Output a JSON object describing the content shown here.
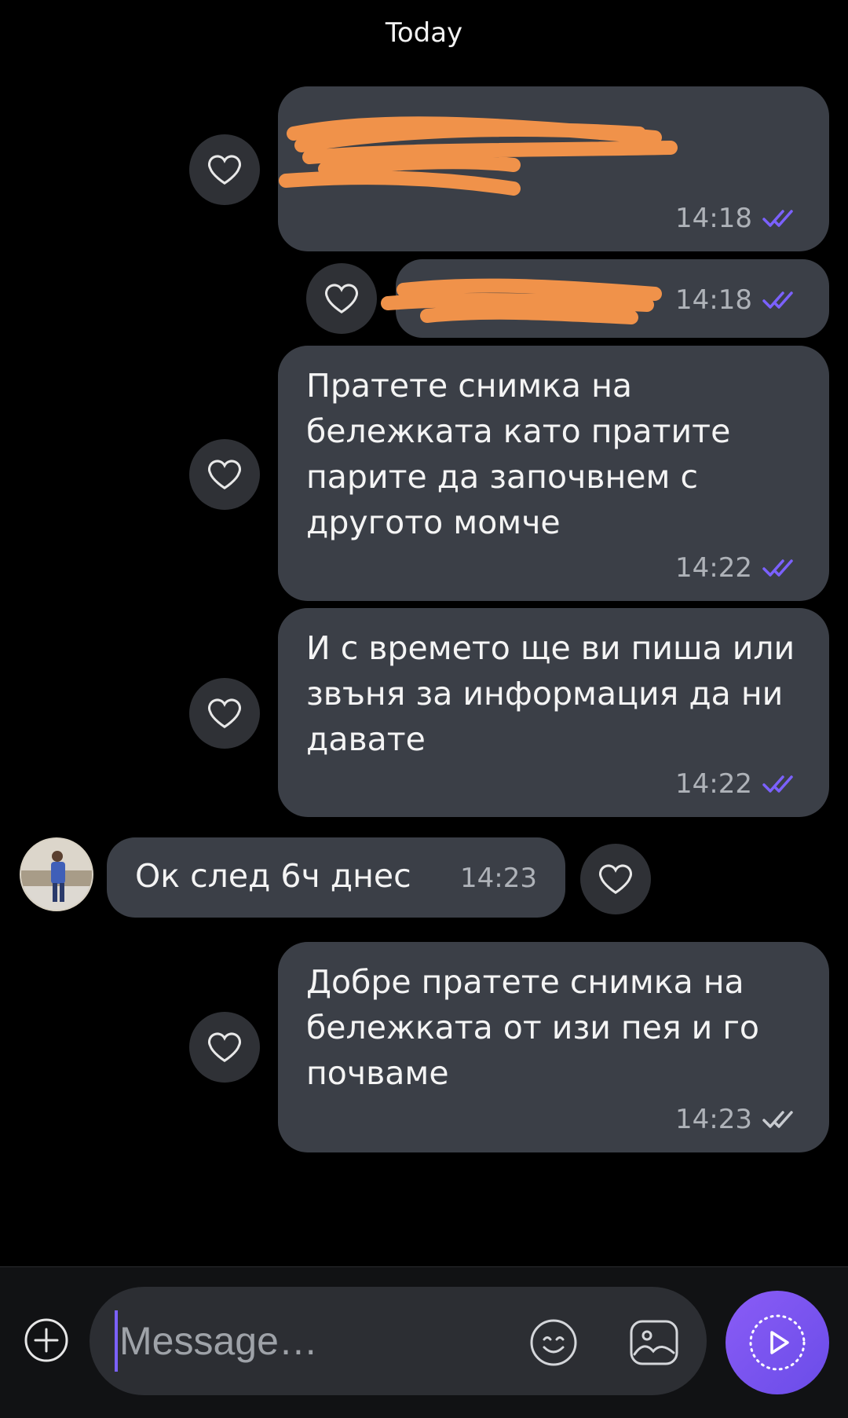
{
  "date_separator": "Today",
  "messages": [
    {
      "id": "m1",
      "direction": "outgoing",
      "text": "",
      "time": "14:18",
      "read": true,
      "redacted": true
    },
    {
      "id": "m2",
      "direction": "outgoing",
      "text": "",
      "time": "14:18",
      "read": true,
      "redacted": true
    },
    {
      "id": "m3",
      "direction": "outgoing",
      "text": "Пратете снимка на бележката като пратите парите да започвнем с другото момче",
      "time": "14:22",
      "read": true
    },
    {
      "id": "m4",
      "direction": "outgoing",
      "text": "И с времето ще ви пиша или звъня за информация да ни давате",
      "time": "14:22",
      "read": true
    },
    {
      "id": "m5",
      "direction": "incoming",
      "text": "Ок след 6ч днес",
      "time": "14:23"
    },
    {
      "id": "m6",
      "direction": "outgoing",
      "text": "Добре пратете снимка на бележката от изи пея и го почваме",
      "time": "14:23",
      "read": false
    }
  ],
  "composer": {
    "placeholder": "Message…",
    "value": ""
  },
  "icons": {
    "like": "heart-icon",
    "attach": "plus-circle-icon",
    "emoji": "smiley-icon",
    "gallery": "image-icon",
    "send": "send-icon"
  },
  "colors": {
    "background": "#000000",
    "bubble": "#3b3f47",
    "read_ticks": "#7b61ff",
    "unread_ticks": "#c8cbd0",
    "accent": "#7b61ff",
    "redaction": "#f0924a"
  }
}
